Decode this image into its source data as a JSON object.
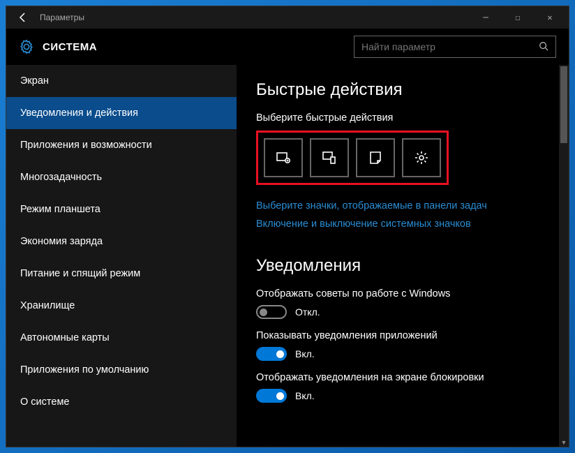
{
  "titlebar": {
    "title": "Параметры"
  },
  "header": {
    "title": "СИСТЕМА",
    "search_placeholder": "Найти параметр"
  },
  "sidebar": {
    "items": [
      {
        "label": "Экран",
        "active": false
      },
      {
        "label": "Уведомления и действия",
        "active": true
      },
      {
        "label": "Приложения и возможности",
        "active": false
      },
      {
        "label": "Многозадачность",
        "active": false
      },
      {
        "label": "Режим планшета",
        "active": false
      },
      {
        "label": "Экономия заряда",
        "active": false
      },
      {
        "label": "Питание и спящий режим",
        "active": false
      },
      {
        "label": "Хранилище",
        "active": false
      },
      {
        "label": "Автономные карты",
        "active": false
      },
      {
        "label": "Приложения по умолчанию",
        "active": false
      },
      {
        "label": "О системе",
        "active": false
      }
    ]
  },
  "content": {
    "quick_actions_title": "Быстрые действия",
    "quick_actions_subtitle": "Выберите быстрые действия",
    "quick_tiles": [
      {
        "icon": "tablet-mode-icon"
      },
      {
        "icon": "connect-icon"
      },
      {
        "icon": "note-icon"
      },
      {
        "icon": "settings-icon"
      }
    ],
    "link1": "Выберите значки, отображаемые в панели задач",
    "link2": "Включение и выключение системных значков",
    "notifications_title": "Уведомления",
    "toggles": [
      {
        "label": "Отображать советы по работе с Windows",
        "state": "off",
        "text": "Откл."
      },
      {
        "label": "Показывать уведомления приложений",
        "state": "on",
        "text": "Вкл."
      },
      {
        "label": "Отображать уведомления на экране блокировки",
        "state": "on",
        "text": "Вкл."
      }
    ]
  }
}
